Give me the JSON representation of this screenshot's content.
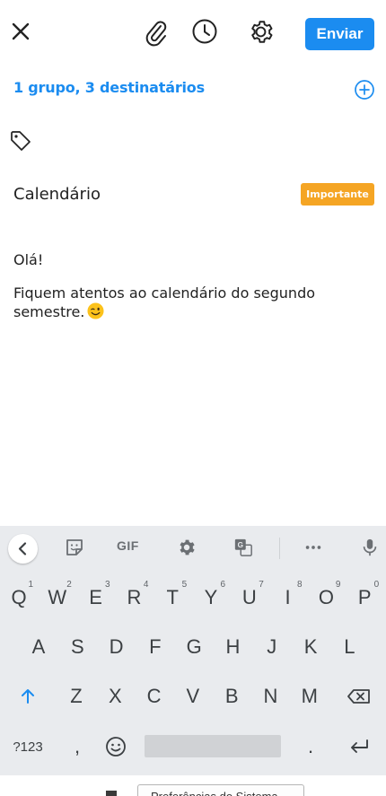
{
  "toolbar": {
    "close_icon": "close-icon",
    "attach_icon": "paperclip-icon",
    "schedule_icon": "clock-icon",
    "settings_icon": "gear-icon",
    "send_label": "Enviar",
    "accent": "#1b8cf0"
  },
  "recipients": {
    "summary": "1 grupo, 3 destinatários",
    "add_icon": "plus-circle-icon"
  },
  "tag_icon": "tag-icon",
  "message": {
    "subject": "Calendário",
    "badge": "Importante",
    "badge_color": "#f5a524",
    "greeting": "Olá!",
    "body": "Fiquem atentos ao calendário do segundo semestre.",
    "emoji": "winking-face"
  },
  "keyboard": {
    "toolbar": {
      "back_icon": "chevron-left-icon",
      "sticker_icon": "sticker-icon",
      "gif_label": "GIF",
      "settings_icon": "gear-icon",
      "translate_icon": "translate-icon",
      "more_icon": "more-icon",
      "mic_icon": "mic-icon"
    },
    "row1": [
      {
        "k": "Q",
        "n": "1"
      },
      {
        "k": "W",
        "n": "2"
      },
      {
        "k": "E",
        "n": "3"
      },
      {
        "k": "R",
        "n": "4"
      },
      {
        "k": "T",
        "n": "5"
      },
      {
        "k": "Y",
        "n": "6"
      },
      {
        "k": "U",
        "n": "7"
      },
      {
        "k": "I",
        "n": "8"
      },
      {
        "k": "O",
        "n": "9"
      },
      {
        "k": "P",
        "n": "0"
      }
    ],
    "row2": [
      "A",
      "S",
      "D",
      "F",
      "G",
      "H",
      "J",
      "K",
      "L"
    ],
    "row3": [
      "Z",
      "X",
      "C",
      "V",
      "B",
      "N",
      "M"
    ],
    "shift_icon": "shift-arrow-icon",
    "backspace_icon": "backspace-icon",
    "symbols_label": "?123",
    "comma": ",",
    "emoji_icon": "smiley-icon",
    "period": ".",
    "enter_icon": "enter-icon"
  },
  "system": {
    "tooltip": "Preferências do Sistema"
  }
}
